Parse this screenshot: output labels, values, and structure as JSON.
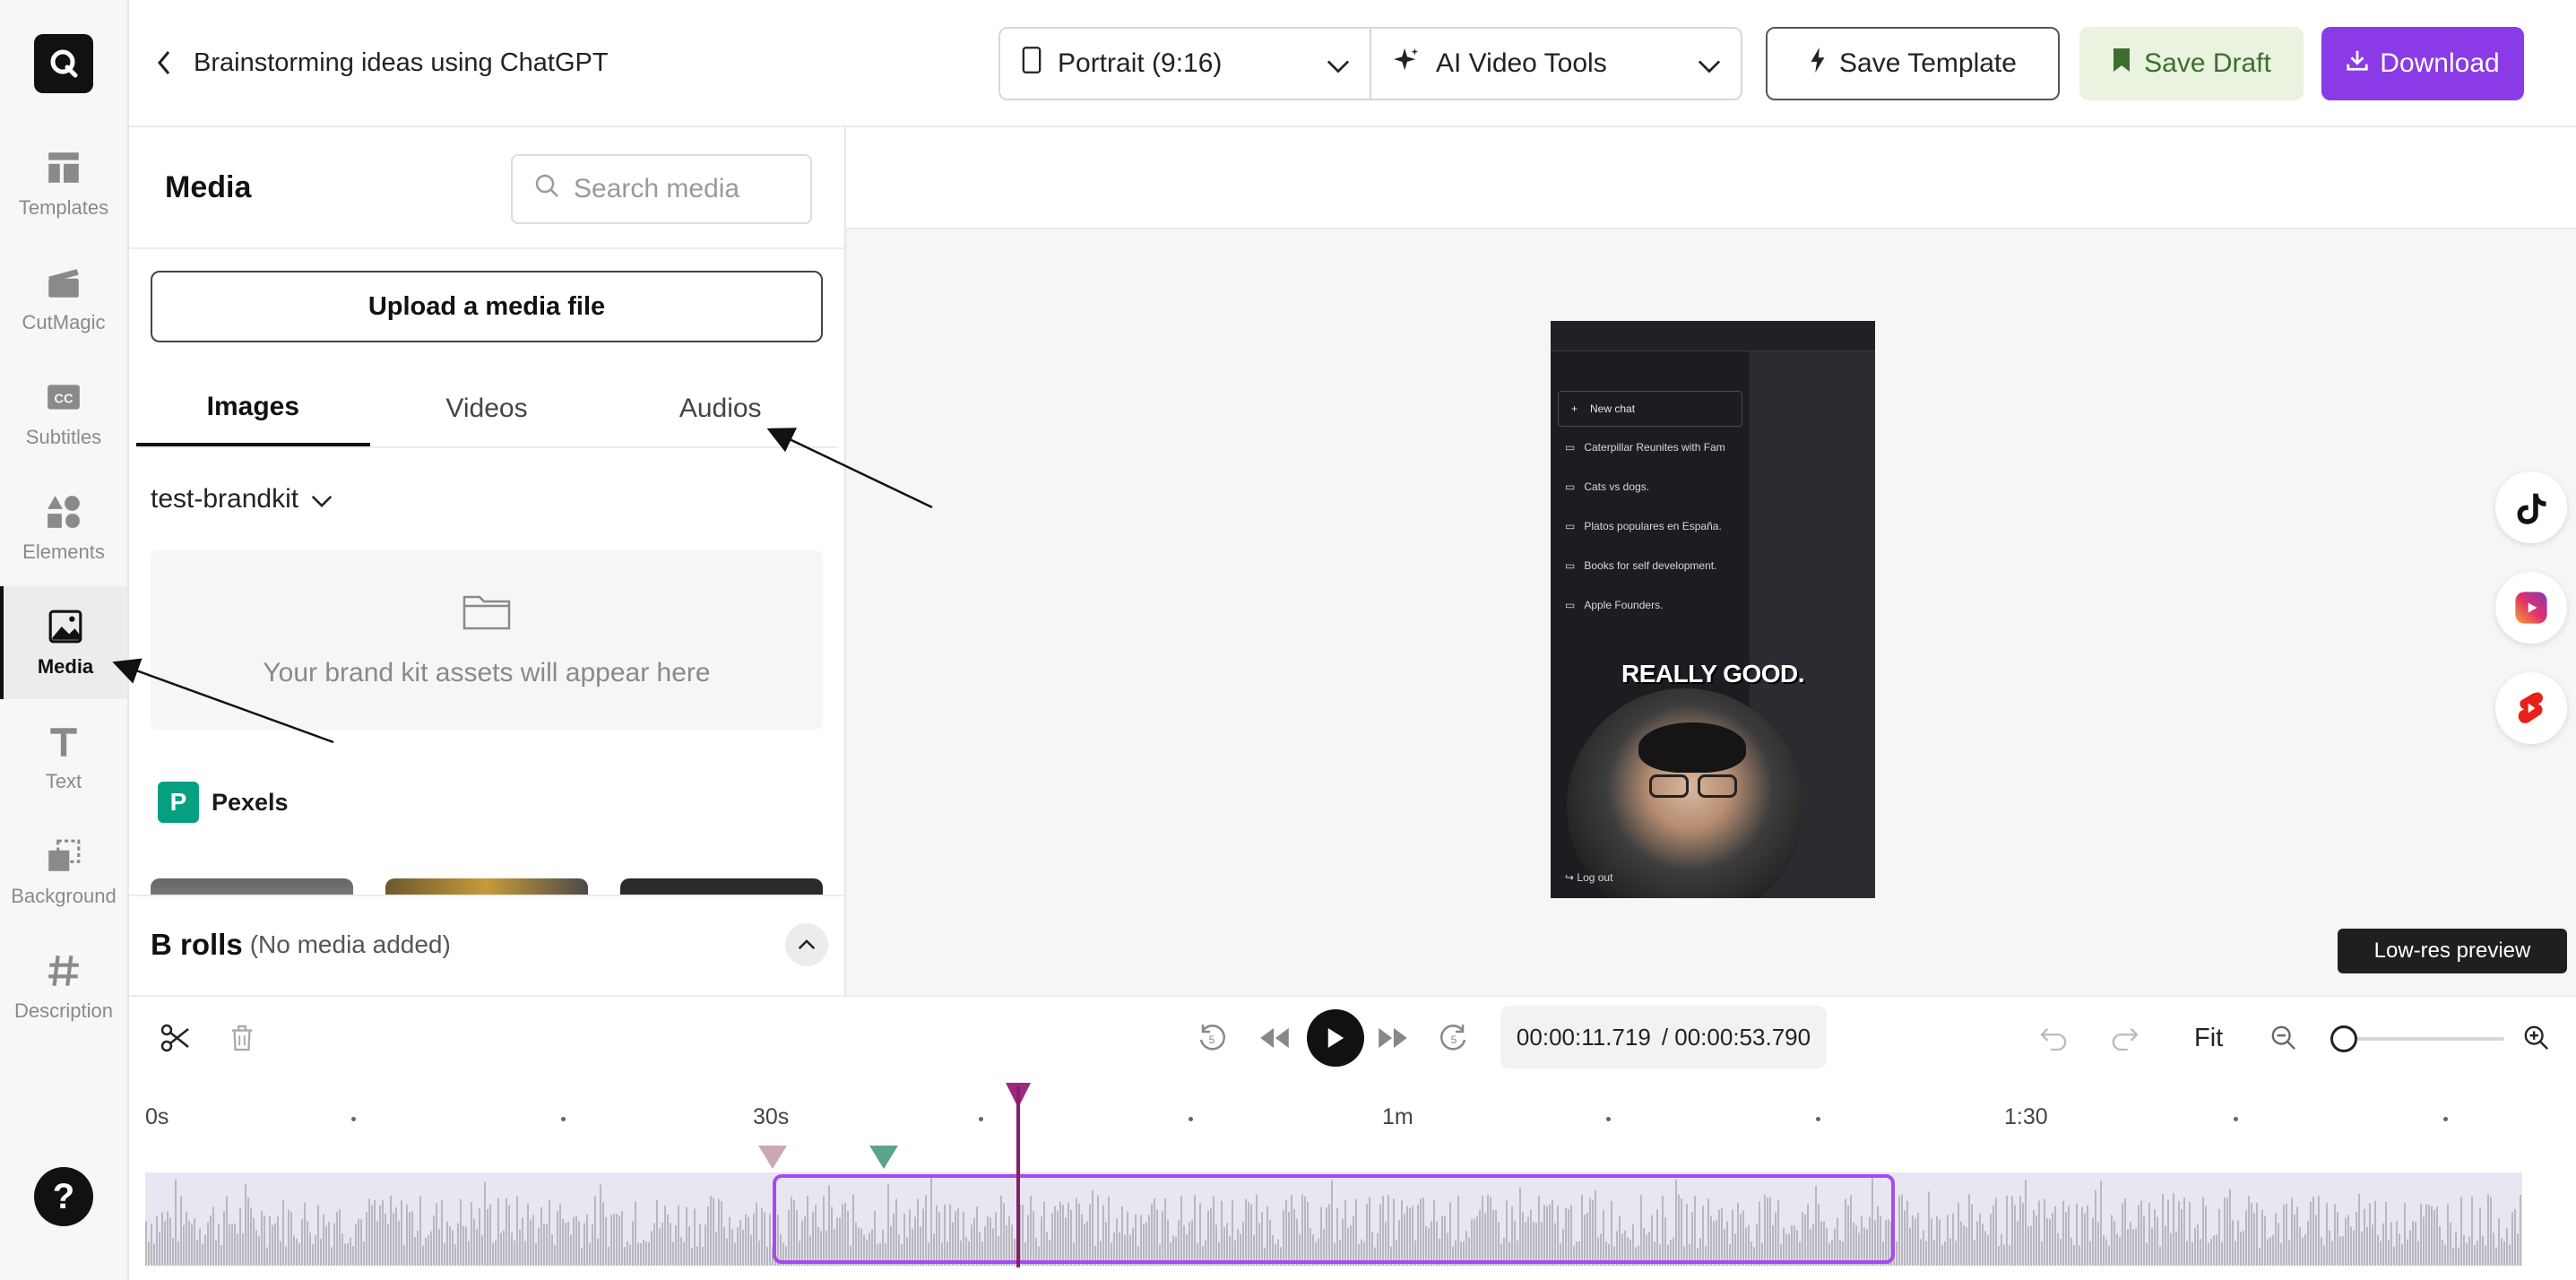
{
  "sidebar": {
    "items": [
      {
        "label": "Templates",
        "icon": "templates-icon"
      },
      {
        "label": "CutMagic",
        "icon": "clapperboard-icon"
      },
      {
        "label": "Subtitles",
        "icon": "cc-icon"
      },
      {
        "label": "Elements",
        "icon": "shapes-icon"
      },
      {
        "label": "Media",
        "icon": "image-icon"
      },
      {
        "label": "Text",
        "icon": "text-icon"
      },
      {
        "label": "Background",
        "icon": "background-icon"
      },
      {
        "label": "Description",
        "icon": "hash-icon"
      }
    ],
    "active": "Media",
    "help_label": "?"
  },
  "header": {
    "title": "Brainstorming ideas using ChatGPT",
    "format_dropdown": "Portrait (9:16)",
    "tools_dropdown": "AI Video Tools",
    "save_template": "Save Template",
    "save_draft": "Save Draft",
    "download": "Download"
  },
  "media_panel": {
    "title": "Media",
    "search_placeholder": "Search media",
    "upload_label": "Upload a media file",
    "tabs": [
      "Images",
      "Videos",
      "Audios"
    ],
    "active_tab": "Images",
    "brandkit": "test-brandkit",
    "brandkit_empty": "Your brand kit assets will appear here",
    "pexels_label": "Pexels",
    "brolls_title": "B rolls",
    "brolls_sub": "(No media added)"
  },
  "preview": {
    "new_chat": "New chat",
    "chats": [
      "Caterpillar Reunites with Fam",
      "Cats vs dogs.",
      "Platos populares en España.",
      "Books for self development.",
      "Apple Founders."
    ],
    "caption": "REALLY GOOD.",
    "logout": "Log out",
    "lowres_badge": "Low-res preview"
  },
  "timeline": {
    "current_time": "00:00:11.719",
    "total_time": "/ 00:00:53.790",
    "fit_label": "Fit",
    "ruler": [
      "0s",
      "30s",
      "1m",
      "1:30"
    ]
  },
  "colors": {
    "accent": "#8a3ae6",
    "draft_bg": "#e9f3df",
    "clip_border": "#a54bf0",
    "playhead": "#8a1d6a"
  }
}
